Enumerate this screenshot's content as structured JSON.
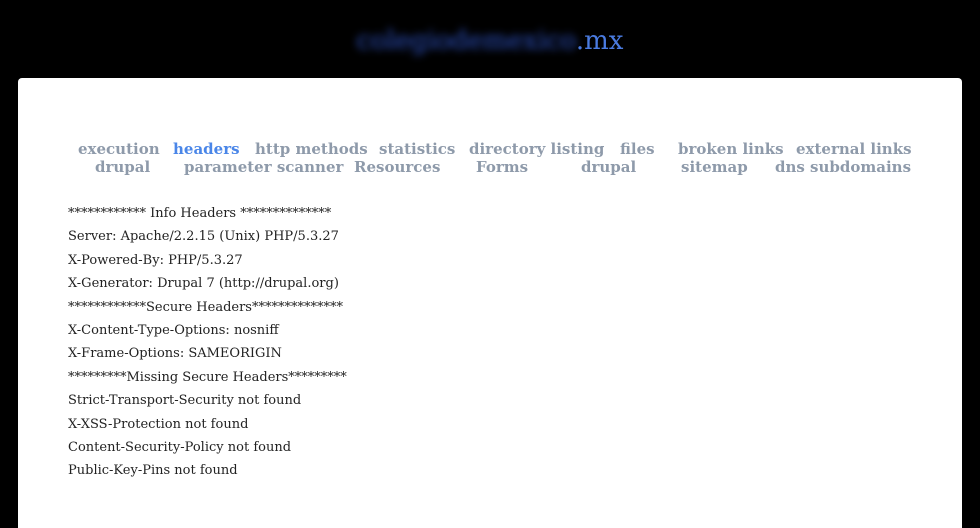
{
  "header": {
    "domain_prefix_obscured": "colegiodemexico",
    "domain_suffix": ".mx"
  },
  "nav": {
    "row1": [
      {
        "label": "execution",
        "active": false
      },
      {
        "label": "headers",
        "active": true
      },
      {
        "label": "http methods",
        "active": false
      },
      {
        "label": "statistics",
        "active": false
      },
      {
        "label": "directory listing",
        "active": false
      },
      {
        "label": "files",
        "active": false
      },
      {
        "label": "broken links",
        "active": false
      },
      {
        "label": "external links",
        "active": false
      }
    ],
    "row2": [
      {
        "label": "drupal",
        "active": false
      },
      {
        "label": "parameter scanner",
        "active": false
      },
      {
        "label": "Resources",
        "active": false
      },
      {
        "label": "Forms",
        "active": false
      },
      {
        "label": "drupal",
        "active": false
      },
      {
        "label": "sitemap",
        "active": false
      },
      {
        "label": "dns subdomains",
        "active": false
      }
    ]
  },
  "results": {
    "lines": [
      "************ Info Headers **************",
      "Server: Apache/2.2.15 (Unix) PHP/5.3.27",
      "X-Powered-By: PHP/5.3.27",
      "X-Generator: Drupal 7 (http://drupal.org)",
      "************Secure Headers**************",
      "X-Content-Type-Options: nosniff",
      "X-Frame-Options: SAMEORIGIN",
      "*********Missing Secure Headers*********",
      "Strict-Transport-Security not found",
      "X-XSS-Protection not found",
      "Content-Security-Policy not found",
      "Public-Key-Pins not found"
    ]
  },
  "colors": {
    "background": "#000000",
    "panel": "#ffffff",
    "nav_link": "#8e9aaa",
    "nav_active": "#4a86e8",
    "title": "#4a7be0"
  }
}
